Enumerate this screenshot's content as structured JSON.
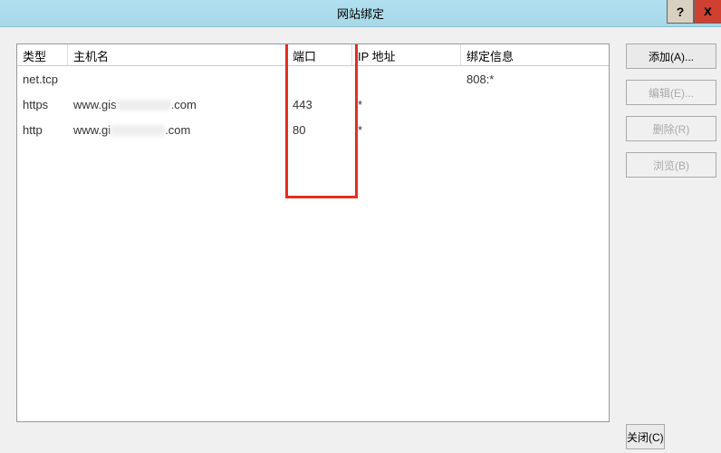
{
  "titlebar": {
    "title": "网站绑定",
    "help_label": "?",
    "close_label": "x"
  },
  "table": {
    "headers": {
      "type": "类型",
      "host": "主机名",
      "port": "端口",
      "ip": "IP 地址",
      "bind": "绑定信息"
    },
    "rows": [
      {
        "type": "net.tcp",
        "host": "",
        "port": "",
        "ip": "",
        "bind": "808:*"
      },
      {
        "type": "https",
        "host_prefix": "www.gis",
        "host_suffix": ".com",
        "port": "443",
        "ip": "*",
        "bind": ""
      },
      {
        "type": "http",
        "host_prefix": "www.gi",
        "host_suffix": ".com",
        "port": "80",
        "ip": "*",
        "bind": ""
      }
    ]
  },
  "buttons": {
    "add": "添加(A)...",
    "edit": "编辑(E)...",
    "delete": "删除(R)",
    "browse": "浏览(B)",
    "close": "关闭(C)"
  }
}
